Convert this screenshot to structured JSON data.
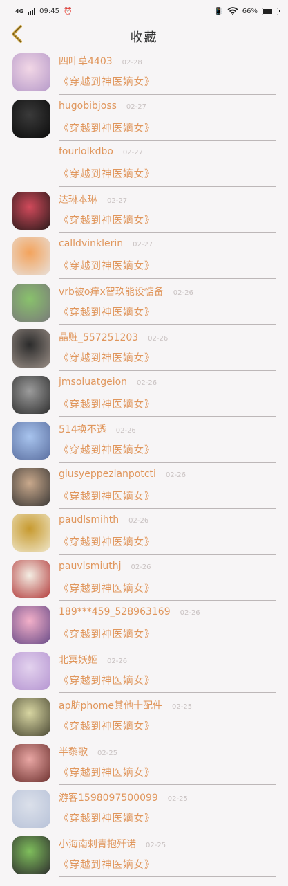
{
  "status": {
    "network": "4G",
    "time": "09:45",
    "battery": "66%",
    "battery_level": 0.66
  },
  "header": {
    "title": "收藏"
  },
  "book_title": "《穿越到神医嫡女》",
  "items": [
    {
      "user": "四叶草4403",
      "date": "02-28",
      "avatar": [
        "#f2d7e6",
        "#b69ac9"
      ]
    },
    {
      "user": "hugobibjoss",
      "date": "02-27",
      "avatar": [
        "#3a3a3a",
        "#0c0c0c"
      ]
    },
    {
      "user": "fourlolkdbo",
      "date": "02-27",
      "avatar": null
    },
    {
      "user": "达琳本琳",
      "date": "02-27",
      "avatar": [
        "#d14a5b",
        "#2a1a1a"
      ]
    },
    {
      "user": "calldvinklerin",
      "date": "02-27",
      "avatar": [
        "#f3a35c",
        "#e8e1dc"
      ]
    },
    {
      "user": "vrb被o痒x智玖能设惦备",
      "date": "02-26",
      "avatar": [
        "#89c26c",
        "#7a7a7a"
      ]
    },
    {
      "user": "晶赃_557251203",
      "date": "02-26",
      "avatar": [
        "#2b2b2b",
        "#9a8e86"
      ]
    },
    {
      "user": "jmsoluatgeion",
      "date": "02-26",
      "avatar": [
        "#9c9c9c",
        "#2e2e2e"
      ]
    },
    {
      "user": "514换不透",
      "date": "02-26",
      "avatar": [
        "#a8c4ee",
        "#5b6fa0"
      ]
    },
    {
      "user": "giusyeppezlanpotcti",
      "date": "02-26",
      "avatar": [
        "#c9a98c",
        "#3b3836"
      ]
    },
    {
      "user": "paudlsmihth",
      "date": "02-26",
      "avatar": [
        "#c79a2f",
        "#efe6c9"
      ]
    },
    {
      "user": "pauvlsmiuthj",
      "date": "02-26",
      "avatar": [
        "#f4eee4",
        "#b23b3b"
      ]
    },
    {
      "user": "189***459_528963169",
      "date": "02-26",
      "avatar": [
        "#f3b0c9",
        "#6a4c88"
      ]
    },
    {
      "user": "北冥妖姬",
      "date": "02-26",
      "avatar": [
        "#e3d2ee",
        "#b595d1"
      ]
    },
    {
      "user": "ap肪phome其他十配件",
      "date": "02-25",
      "avatar": [
        "#d8d6a2",
        "#4d4b36"
      ]
    },
    {
      "user": "半黎歌",
      "date": "02-25",
      "avatar": [
        "#e9a7a4",
        "#6e3230"
      ]
    },
    {
      "user": "游客1598097500099",
      "date": "02-25",
      "avatar": [
        "#dbe0ea",
        "#b8c2d8"
      ]
    },
    {
      "user": "小海南剌青抱歼诺",
      "date": "02-25",
      "avatar": [
        "#7fbf5c",
        "#2e2e2e"
      ]
    }
  ]
}
